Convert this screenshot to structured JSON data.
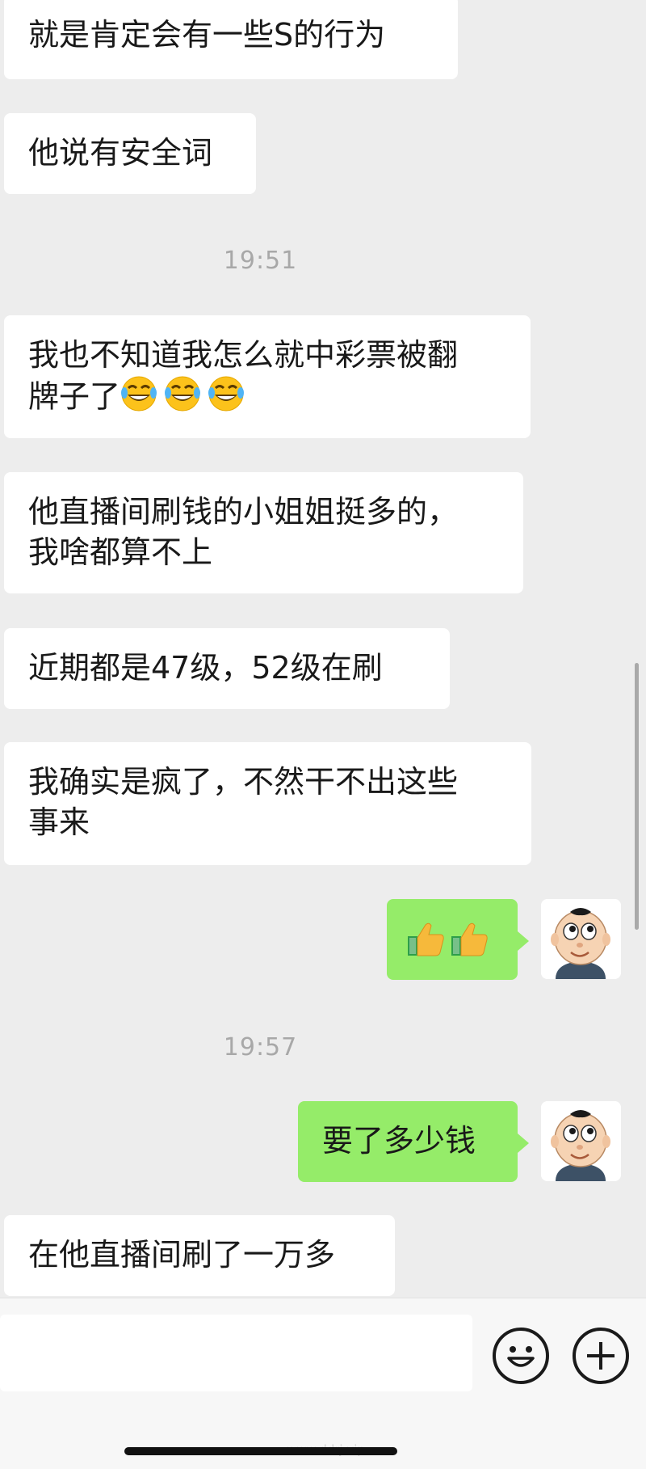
{
  "messages": [
    {
      "side": "left",
      "text": "就是肯定会有一些S的行为"
    },
    {
      "side": "left",
      "text": "他说有安全词"
    },
    {
      "type": "time",
      "text": "19:51"
    },
    {
      "side": "left",
      "line1": "我也不知道我怎么就中彩票被翻",
      "line2": "牌子了",
      "emoji": "crying-laughing-face-icon x3"
    },
    {
      "side": "left",
      "line1": "他直播间刷钱的小姐姐挺多的，",
      "line2": "我啥都算不上"
    },
    {
      "side": "left",
      "text": "近期都是47级，52级在刷"
    },
    {
      "side": "left",
      "line1": "我确实是疯了，不然干不出这些",
      "line2": "事来"
    },
    {
      "side": "right",
      "emoji": "thumbs-up-icon x2"
    },
    {
      "type": "time",
      "text": "19:57"
    },
    {
      "side": "right",
      "text": "要了多少钱"
    },
    {
      "side": "left",
      "text": "在他直播间刷了一万多"
    }
  ],
  "input": {
    "placeholder": "",
    "value": ""
  },
  "icons": {
    "emoji_button": "smiley-icon",
    "more_button": "plus-icon"
  },
  "colors": {
    "background": "#ededed",
    "left_bubble": "#ffffff",
    "right_bubble": "#95ec69"
  },
  "watermark": "www.ddrj.vip"
}
